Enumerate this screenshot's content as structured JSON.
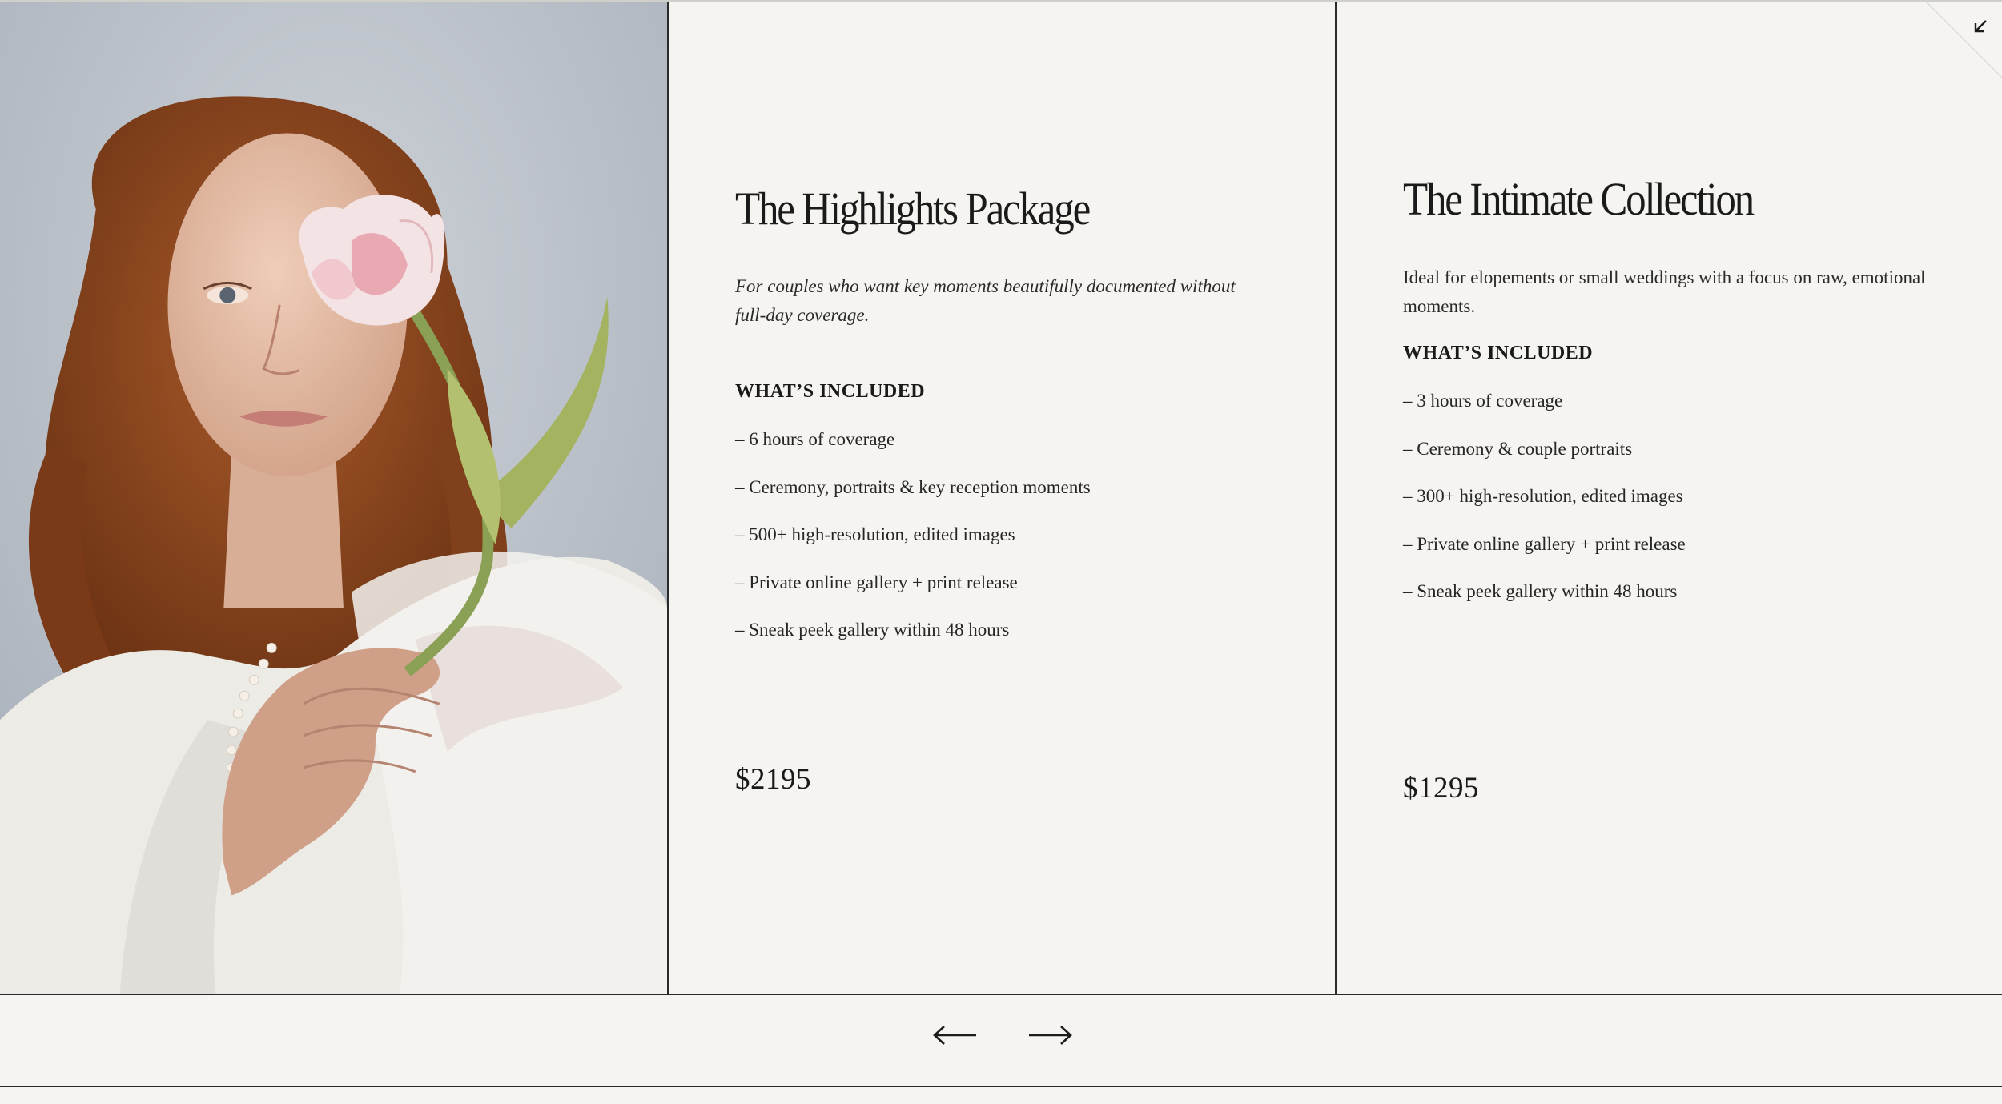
{
  "packages": [
    {
      "title": "The Highlights Package",
      "description": "For couples who want key moments beautifully documented without full-day coverage.",
      "included_heading": "WHAT’S INCLUDED",
      "items": [
        "– 6 hours of coverage",
        "– Ceremony, portraits & key reception moments",
        "– 500+ high-resolution, edited images",
        "– Private online gallery + print release",
        "– Sneak peek gallery within 48 hours"
      ],
      "price": "$2195"
    },
    {
      "title": "The Intimate Collection",
      "description": "Ideal for elopements or small weddings with a focus on raw, emotional moments.",
      "included_heading": "WHAT’S INCLUDED",
      "items": [
        "– 3 hours of coverage",
        "– Ceremony & couple portraits",
        "– 300+ high-resolution, edited images",
        "– Private online gallery + print release",
        "– Sneak peek gallery within 48 hours"
      ],
      "price": "$1295"
    }
  ],
  "icons": {
    "collapse": "collapse-arrow-icon",
    "prev": "arrow-left-icon",
    "next": "arrow-right-icon"
  },
  "colors": {
    "background": "#f5f4f0",
    "text": "#1c1c1c",
    "divider": "#2a2a2a"
  }
}
